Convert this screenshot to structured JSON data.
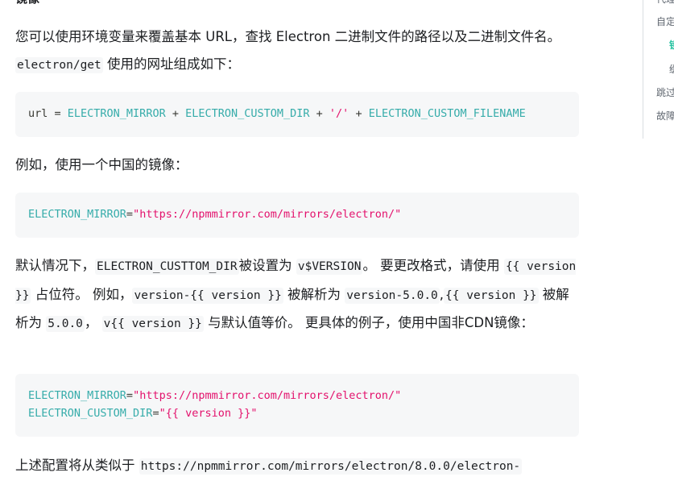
{
  "section_heading": "镜像",
  "para1": {
    "text_a": "您可以使用环境变量来覆盖基本 URL，查找 Electron 二进制文件的路径以及二进制文件名。",
    "code": "electron/get",
    "text_b": " 使用的网址组成如下："
  },
  "code1": {
    "url_label": "url",
    "eq": " = ",
    "mirror": "ELECTRON_MIRROR",
    "plus1": " + ",
    "dir": "ELECTRON_CUSTOM_DIR",
    "plus2": " + ",
    "slash": "'/'",
    "plus3": " + ",
    "filename": "ELECTRON_CUSTOM_FILENAME"
  },
  "para2": {
    "text": "例如，使用一个中国的镜像："
  },
  "code2": {
    "name": "ELECTRON_MIRROR",
    "eq": "=",
    "value": "\"https://npmmirror.com/mirrors/electron/\""
  },
  "para3": {
    "t1": "默认情况下，",
    "c1": "ELECTRON_CUSTTOM_DIR",
    "t2": "被设置为 ",
    "c2": "v$VERSION",
    "t3": "。 要更改格式，请使用 ",
    "c3": "{{ version }}",
    "t4": " 占位符。 例如，",
    "c4": "version-{{ version }}",
    "t5": " 被解析为 ",
    "c5": "version-5.0.0",
    "t6": ",",
    "c6": "{{ version }}",
    "t7": " 被解析为 ",
    "c7": "5.0.0",
    "t8": "， ",
    "c8": "v{{ version }}",
    "t9": " 与默认值等价。 更具体的例子，使用中国非CDN镜像："
  },
  "code3": {
    "line1_name": "ELECTRON_MIRROR",
    "line1_eq": "=",
    "line1_value": "\"https://npmmirror.com/mirrors/electron/\"",
    "line2_name": "ELECTRON_CUSTOM_DIR",
    "line2_eq": "=",
    "line2_value": "\"{{ version }}\""
  },
  "para4": {
    "text": "上述配置将从类似于 ",
    "code": "https://npmmirror.com/mirrors/electron/8.0.0/electron-"
  },
  "toc": {
    "items": [
      {
        "label": "代理",
        "active": false
      },
      {
        "label": "自定",
        "active": false
      },
      {
        "label": "镜",
        "active": true
      },
      {
        "label": "缓",
        "active": false
      },
      {
        "label": "跳过",
        "active": false
      },
      {
        "label": "故障",
        "active": false
      }
    ]
  },
  "colors": {
    "accent": "#25c2a0",
    "code_bg": "#f6f7f8",
    "token_variable": "#36acaa",
    "token_string": "#e3116c"
  }
}
